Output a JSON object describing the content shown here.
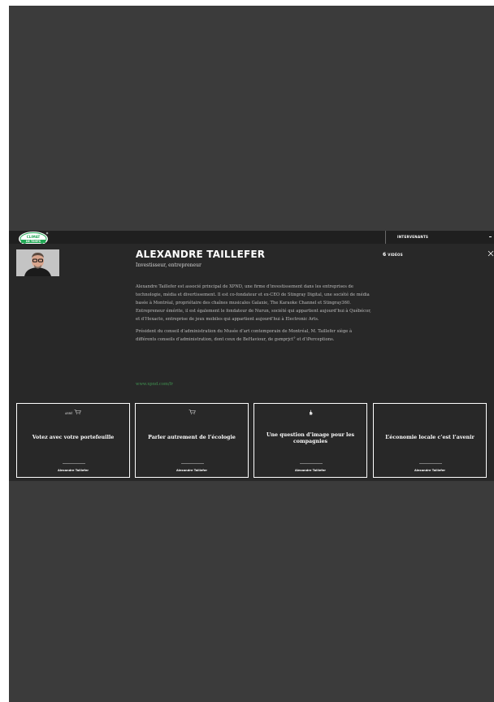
{
  "header": {
    "logo_line1": "CLIMAT",
    "logo_line2": "DE TEMPS",
    "nav_link": "INTERVENANTS"
  },
  "speaker": {
    "name": "ALEXANDRE TAILLEFER",
    "role": "Investisseur, entrepreneur",
    "bio": [
      "Alexandre Taillefer est associé principal de XPND, une firme d’investissement dans les entreprises de technologie, média et divertissement. Il est co-fondateur et ex-CEO de Stingray Digital, une société de média basée à Montréal, propriétaire des chaînes musicales Galaxie, The Karaoke Channel et Stingray360. Entrepreneur émérite, il est également le fondateur de Nurun, société qui appartient aujourd’hui à Québécor, et d’Hexacto, entreprise de jeux mobiles qui appartient aujourd’hui à Electronic Arts.",
      "Président du conseil d’administration du Musée d’art contemporain de Montréal, M. Taillefer siège à différents conseils d’administration, dont ceux de BeHaviour, de gsmprjct° et d’iPerceptions."
    ],
    "website": "www.xpnd.com/fr",
    "videos_count": "6",
    "videos_label": "VIDÉOS"
  },
  "icons": {
    "logo": "climat-logo-icon",
    "close": "close-icon",
    "cart": "cart-icon",
    "hand": "hand-icon"
  },
  "colors": {
    "backdrop": "#3b3b3b",
    "panel": "#282828",
    "accent_green": "#3f8f4f",
    "logo_green": "#22a855"
  },
  "videos": [
    {
      "icon_text": "ARRÊ",
      "title": "Votez avec votre portefeuille",
      "author": "Alexandre Taillefer"
    },
    {
      "icon_text": "",
      "title": "Parler autrement de l’écologie",
      "author": "Alexandre Taillefer"
    },
    {
      "icon_text": "",
      "title": "Une question d’image pour les compagnies",
      "author": "Alexandre Taillefer"
    },
    {
      "icon_text": "",
      "title": "L’économie locale c’est l’avenir",
      "author": "Alexandre Taillefer"
    }
  ]
}
